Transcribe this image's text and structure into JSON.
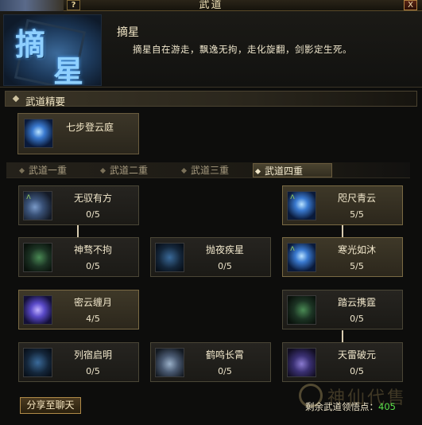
{
  "window": {
    "title": "武道",
    "help_label": "?",
    "close_label": "X"
  },
  "header": {
    "emblem_chars": [
      "摘",
      "星"
    ],
    "skill_name": "摘星",
    "skill_desc": "摘星自在游走，飘逸无拘，走化旋翻，剑影定生死。"
  },
  "essence": {
    "section_label": "武道精要",
    "card": {
      "name": "七步登云庭",
      "icon": "lightning-figure-icon"
    }
  },
  "tabs": [
    {
      "label": "武道一重",
      "active": false
    },
    {
      "label": "武道二重",
      "active": false
    },
    {
      "label": "武道三重",
      "active": false
    },
    {
      "label": "武道四重",
      "active": true
    }
  ],
  "skills": [
    {
      "name": "无驭有方",
      "value": "0/5",
      "icon": "swirl-wind-icon"
    },
    {
      "name": "咫尺青云",
      "value": "5/5",
      "icon": "lightning-figure-icon"
    },
    {
      "name": "神骛不拘",
      "value": "0/5",
      "icon": "green-spiral-icon"
    },
    {
      "name": "抛夜疾星",
      "value": "0/5",
      "icon": "star-dots-icon"
    },
    {
      "name": "寒光如沐",
      "value": "5/5",
      "icon": "blue-burst-icon"
    },
    {
      "name": "密云缠月",
      "value": "4/5",
      "icon": "purple-orb-icon"
    },
    {
      "name": "踏云携霆",
      "value": "0/5",
      "icon": "green-spiral-icon"
    },
    {
      "name": "列宿启明",
      "value": "0/5",
      "icon": "star-dots-icon"
    },
    {
      "name": "鹤鸣长霄",
      "value": "0/5",
      "icon": "scroll-icon"
    },
    {
      "name": "天雷破元",
      "value": "0/5",
      "icon": "violet-figure-icon"
    }
  ],
  "footer": {
    "share_label": "分享至聊天",
    "points_label": "剩余武道领悟点：",
    "points_value": "405"
  },
  "watermark": {
    "text": "神仙代售",
    "url": "WWW.SXDS.COM"
  }
}
